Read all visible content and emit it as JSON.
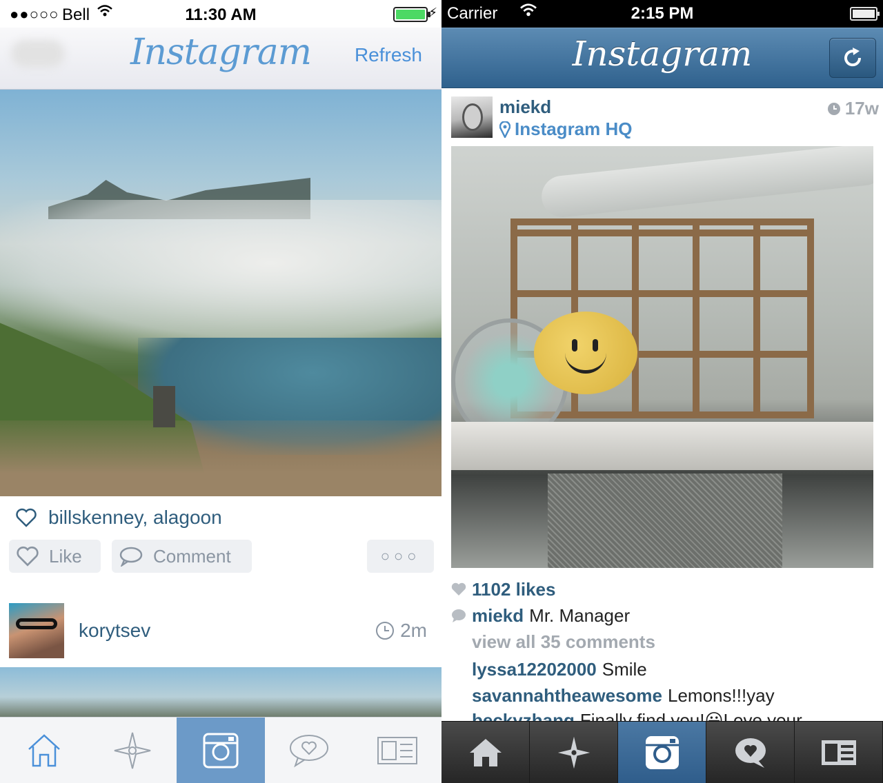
{
  "left": {
    "status": {
      "signal": "●●○○○",
      "carrier": "Bell",
      "wifi": "wifi-icon",
      "time": "11:30 AM",
      "battery": "battery-icon",
      "charge": "charging-icon"
    },
    "nav": {
      "logo": "Instagram",
      "refresh": "Refresh"
    },
    "post1": {
      "likes": "billskenney, alagoon",
      "like_label": "Like",
      "comment_label": "Comment",
      "more_label": "○○○"
    },
    "post2": {
      "username": "korytsev",
      "time": "2m"
    },
    "tabs": [
      {
        "icon": "home-icon"
      },
      {
        "icon": "explore-icon"
      },
      {
        "icon": "camera-icon",
        "active": true
      },
      {
        "icon": "activity-heart-icon"
      },
      {
        "icon": "profile-icon"
      }
    ],
    "colors": {
      "accent": "#5c9bd3",
      "active_tab": "#6c9ac8"
    }
  },
  "right": {
    "status": {
      "carrier": "Carrier",
      "wifi": "wifi-icon",
      "time": "2:15 PM",
      "battery": "battery-icon"
    },
    "nav": {
      "logo": "Instagram",
      "refresh": "refresh-icon"
    },
    "post": {
      "username": "miekd",
      "location": "Instagram HQ",
      "time": "17w",
      "likes": "1102 likes",
      "caption_user": "miekd",
      "caption": "Mr. Manager",
      "view_all": "view all 35 comments",
      "comments": [
        {
          "user": "lyssa12202000",
          "text": "Smile"
        },
        {
          "user": "savannahtheawesome",
          "text": "Lemons!!!yay"
        },
        {
          "user": "beckyzhang",
          "text": "Finally find you!😀Love your"
        }
      ]
    },
    "tabs": [
      {
        "icon": "home-icon"
      },
      {
        "icon": "explore-icon"
      },
      {
        "icon": "camera-icon",
        "active": true
      },
      {
        "icon": "activity-icon"
      },
      {
        "icon": "profile-icon"
      }
    ],
    "colors": {
      "nav_top": "#5c8bb3",
      "nav_bottom": "#2f618d",
      "link": "#2f5d7d"
    }
  }
}
